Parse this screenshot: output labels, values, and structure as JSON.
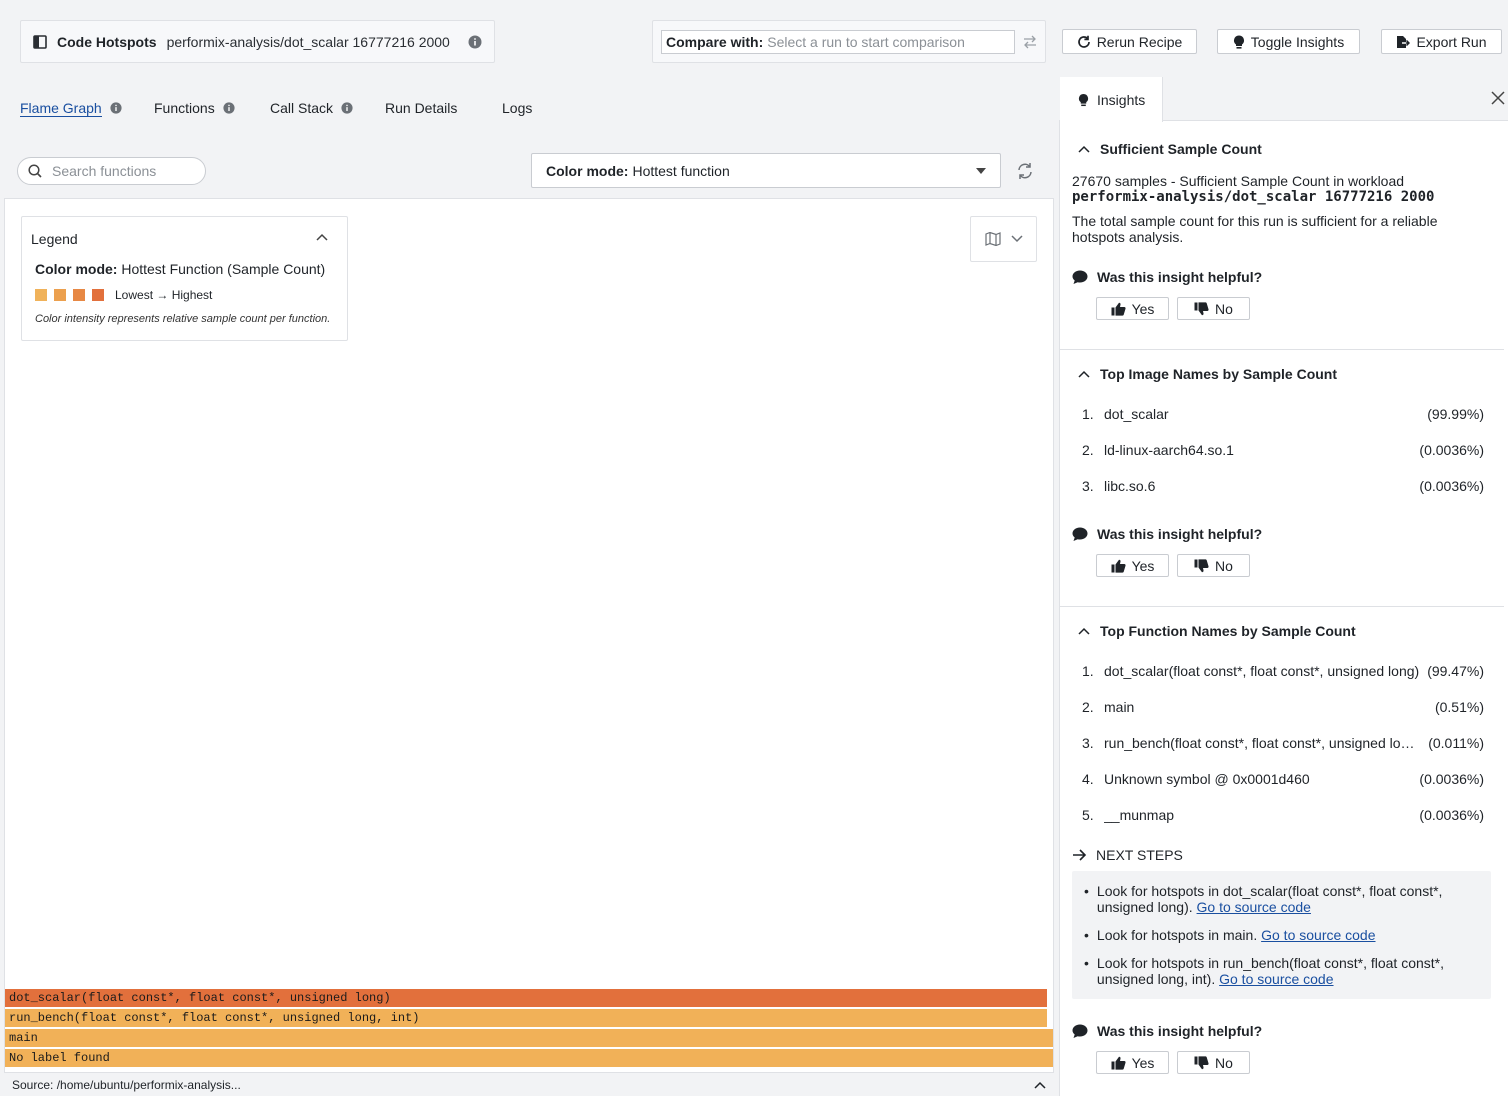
{
  "header": {
    "app_title": "Code Hotspots",
    "run_name": "performix-analysis/dot_scalar 16777216 2000",
    "compare_label": "Compare with:",
    "compare_placeholder": "Select a run to start comparison",
    "rerun_label": "Rerun Recipe",
    "toggle_insights_label": "Toggle Insights",
    "export_label": "Export Run"
  },
  "tabs": [
    {
      "label": "Flame Graph",
      "active": true,
      "info": true
    },
    {
      "label": "Functions",
      "active": false,
      "info": true
    },
    {
      "label": "Call Stack",
      "active": false,
      "info": true
    },
    {
      "label": "Run Details",
      "active": false,
      "info": false
    },
    {
      "label": "Logs",
      "active": false,
      "info": false
    }
  ],
  "toolbar": {
    "search_placeholder": "Search functions",
    "color_mode_label": "Color mode:",
    "color_mode_value": "Hottest function"
  },
  "legend": {
    "title": "Legend",
    "mode_label": "Color mode:",
    "mode_value": "Hottest Function (Sample Count)",
    "range_label": "Lowest → Highest",
    "note": "Color intensity represents relative sample count per function.",
    "swatches": [
      "#f0b25a",
      "#eca04e",
      "#e78844",
      "#e2703c"
    ]
  },
  "flame": [
    {
      "label": "dot_scalar(float const*, float const*, unsigned long)",
      "color": "#e2703c",
      "width_frac": 0.994
    },
    {
      "label": "run_bench(float const*, float const*, unsigned long, int)",
      "color": "#f1b158",
      "width_frac": 0.994
    },
    {
      "label": "main",
      "color": "#f1b158",
      "width_frac": 1.0
    },
    {
      "label": "No label found",
      "color": "#f1b158",
      "width_frac": 1.0
    }
  ],
  "footer": {
    "source": "Source: /home/ubuntu/performix-analysis..."
  },
  "insights": {
    "tab_label": "Insights",
    "helpful_label": "Was this insight helpful?",
    "yes_label": "Yes",
    "no_label": "No",
    "sample": {
      "title": "Sufficient Sample Count",
      "headline": "27670 samples - Sufficient Sample Count in workload",
      "workload": "performix-analysis/dot_scalar 16777216 2000",
      "body": "The total sample count for this run is sufficient for a reliable hotspots analysis."
    },
    "images": {
      "title": "Top Image Names by Sample Count",
      "rows": [
        {
          "num": "1.",
          "name": "dot_scalar",
          "pct": "(99.99%)"
        },
        {
          "num": "2.",
          "name": "ld-linux-aarch64.so.1",
          "pct": "(0.0036%)"
        },
        {
          "num": "3.",
          "name": "libc.so.6",
          "pct": "(0.0036%)"
        }
      ]
    },
    "functions": {
      "title": "Top Function Names by Sample Count",
      "rows": [
        {
          "num": "1.",
          "name": "dot_scalar(float const*, float const*, unsigned long)",
          "pct": "(99.47%)"
        },
        {
          "num": "2.",
          "name": "main",
          "pct": "(0.51%)"
        },
        {
          "num": "3.",
          "name": "run_bench(float const*, float const*, unsigned long, int)",
          "pct": "(0.011%)"
        },
        {
          "num": "4.",
          "name": "Unknown symbol @ 0x0001d460",
          "pct": "(0.0036%)"
        },
        {
          "num": "5.",
          "name": "__munmap",
          "pct": "(0.0036%)"
        }
      ],
      "next_steps_label": "NEXT STEPS",
      "link_label": "Go to source code",
      "next_steps": [
        "Look for hotspots in dot_scalar(float const*, float const*, unsigned long).",
        "Look for hotspots in main.",
        "Look for hotspots in run_bench(float const*, float const*, unsigned long, int)."
      ]
    }
  }
}
